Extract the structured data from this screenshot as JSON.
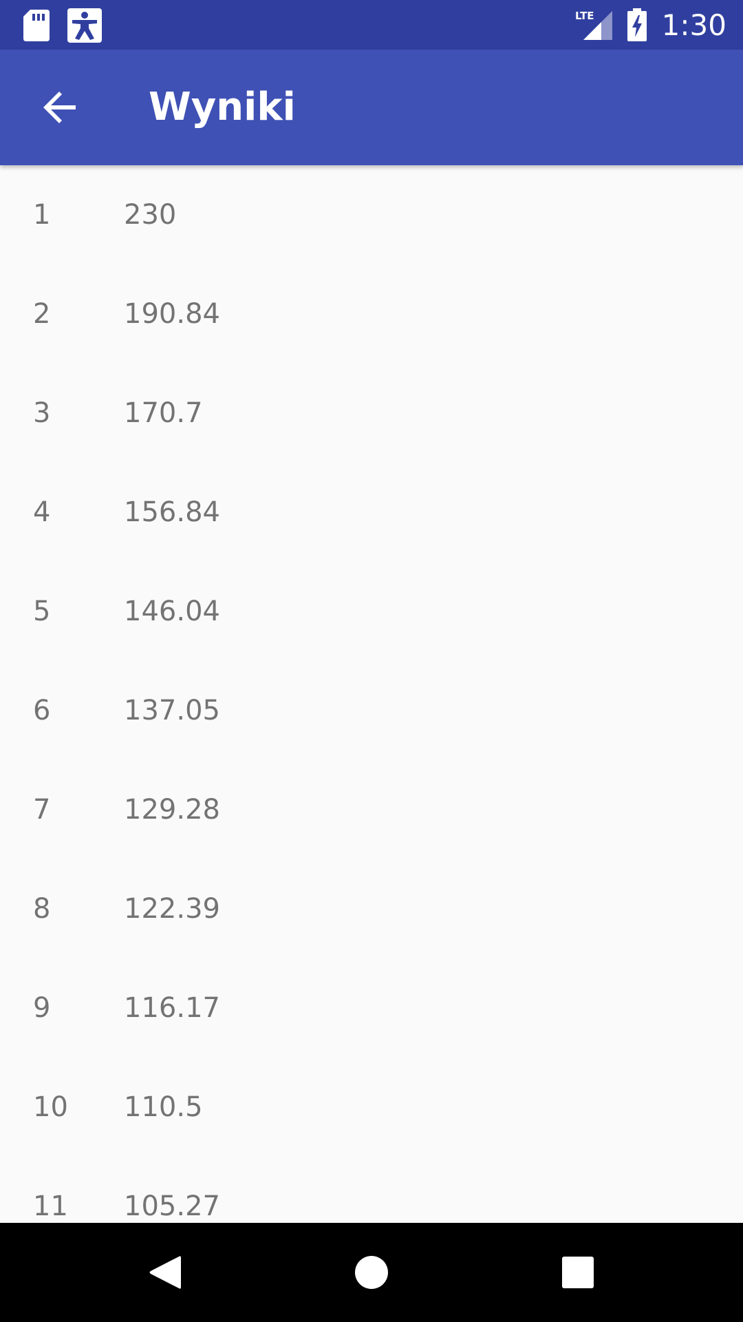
{
  "status_bar": {
    "time": "1:30",
    "network_label": "LTE",
    "icons": [
      "sd-card-icon",
      "accessibility-icon",
      "lte-signal-icon",
      "battery-charging-icon"
    ]
  },
  "app_bar": {
    "title": "Wyniki",
    "back_icon": "arrow-back-icon"
  },
  "colors": {
    "status_bar": "#303f9f",
    "app_bar": "#3f51b5",
    "background": "#fafafa",
    "row_text": "#737373",
    "nav_bar": "#000000"
  },
  "results": [
    {
      "rank": "1",
      "value": "230"
    },
    {
      "rank": "2",
      "value": "190.84"
    },
    {
      "rank": "3",
      "value": "170.7"
    },
    {
      "rank": "4",
      "value": "156.84"
    },
    {
      "rank": "5",
      "value": "146.04"
    },
    {
      "rank": "6",
      "value": "137.05"
    },
    {
      "rank": "7",
      "value": "129.28"
    },
    {
      "rank": "8",
      "value": "122.39"
    },
    {
      "rank": "9",
      "value": "116.17"
    },
    {
      "rank": "10",
      "value": "110.5"
    },
    {
      "rank": "11",
      "value": "105.27"
    }
  ],
  "nav_bar": {
    "icons": [
      "nav-back-icon",
      "nav-home-icon",
      "nav-recents-icon"
    ]
  }
}
